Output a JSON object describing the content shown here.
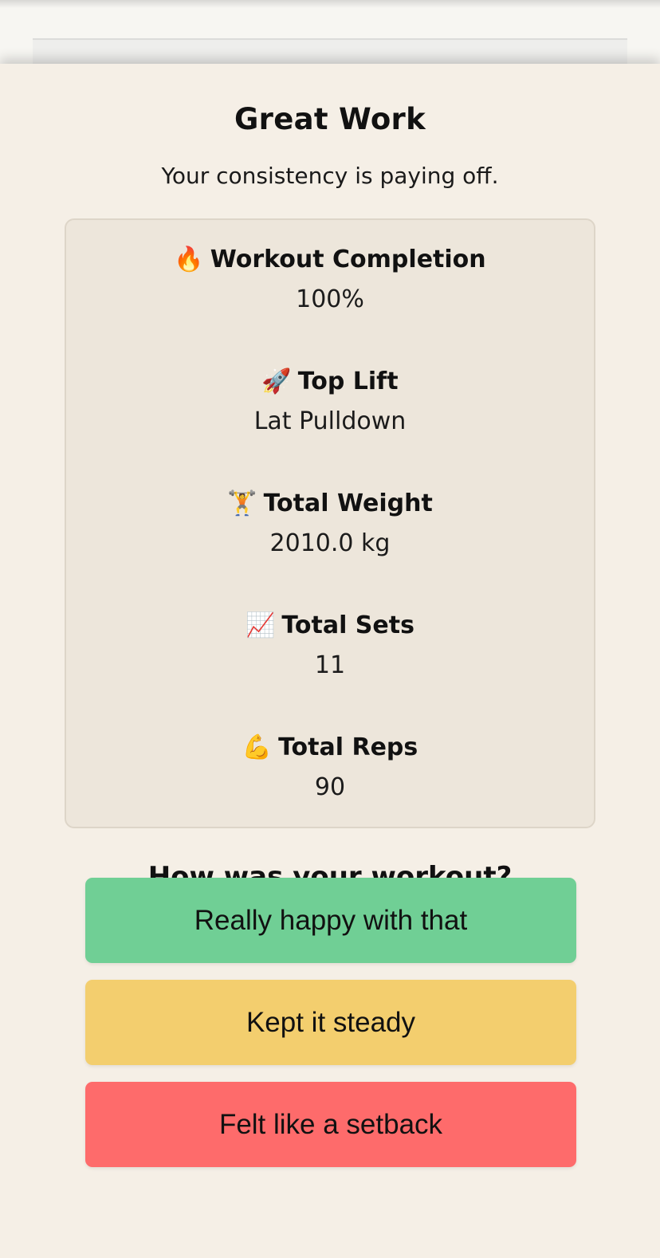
{
  "summary": {
    "title": "Great Work",
    "subtitle": "Your consistency is paying off."
  },
  "stats": [
    {
      "icon": "🔥",
      "icon_name": "fire-icon",
      "label": "Workout Completion",
      "value": "100%"
    },
    {
      "icon": "🚀",
      "icon_name": "rocket-icon",
      "label": "Top Lift",
      "value": "Lat Pulldown"
    },
    {
      "icon": "🏋️",
      "icon_name": "weightlifter-icon",
      "label": "Total Weight",
      "value": "2010.0 kg"
    },
    {
      "icon": "📈",
      "icon_name": "chart-increasing-icon",
      "label": "Total Sets",
      "value": "11"
    },
    {
      "icon": "💪",
      "icon_name": "flexed-biceps-icon",
      "label": "Total Reps",
      "value": "90"
    }
  ],
  "feedback": {
    "question": "How was your workout?",
    "options": [
      {
        "label": "Really happy with that",
        "color": "#70cf95"
      },
      {
        "label": "Kept it steady",
        "color": "#f3ce6e"
      },
      {
        "label": "Felt like a setback",
        "color": "#fe6b6b"
      }
    ]
  }
}
